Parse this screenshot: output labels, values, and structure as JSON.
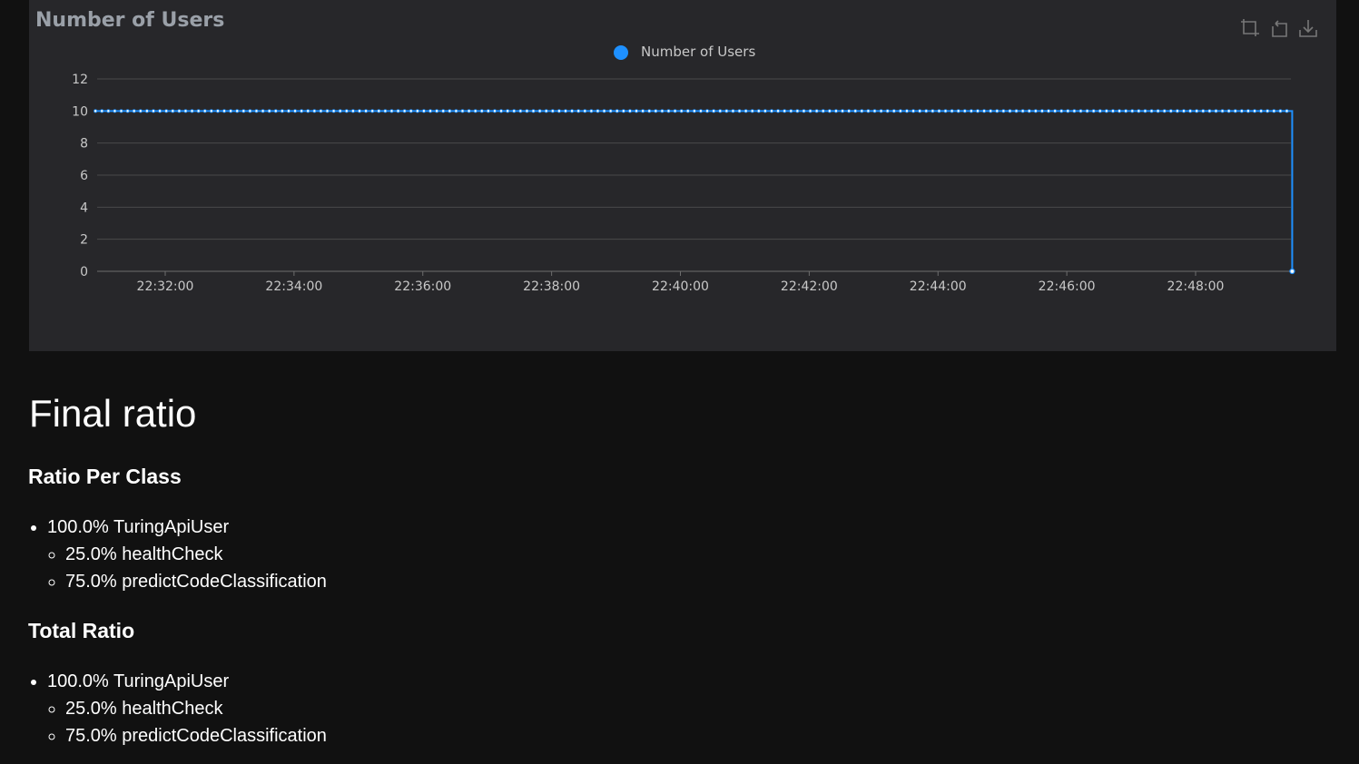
{
  "chart": {
    "title": "Number of Users",
    "toolbox": {
      "zoom_icon": "zoom-select-icon",
      "restore_icon": "restore-icon",
      "download_icon": "download-icon"
    }
  },
  "chart_data": {
    "type": "line",
    "title": "Number of Users",
    "legend": [
      "Number of Users"
    ],
    "legend_position": "top-center",
    "series": [
      {
        "name": "Number of Users",
        "color": "#1e90ff",
        "x_start": "22:30:55",
        "x_end": "22:49:30",
        "value_before_end": 10,
        "value_at_end": 0
      }
    ],
    "xticks": [
      "22:32:00",
      "22:34:00",
      "22:36:00",
      "22:38:00",
      "22:40:00",
      "22:42:00",
      "22:44:00",
      "22:46:00",
      "22:48:00"
    ],
    "yticks": [
      0,
      2,
      4,
      6,
      8,
      10,
      12
    ],
    "ylim": [
      0,
      12
    ],
    "grid": true
  },
  "report": {
    "heading": "Final ratio",
    "sections": [
      {
        "title": "Ratio Per Class",
        "items": [
          {
            "text": "100.0% TuringApiUser",
            "children": [
              "25.0% healthCheck",
              "75.0% predictCodeClassification"
            ]
          }
        ]
      },
      {
        "title": "Total Ratio",
        "items": [
          {
            "text": "100.0% TuringApiUser",
            "children": [
              "25.0% healthCheck",
              "75.0% predictCodeClassification"
            ]
          }
        ]
      }
    ]
  }
}
